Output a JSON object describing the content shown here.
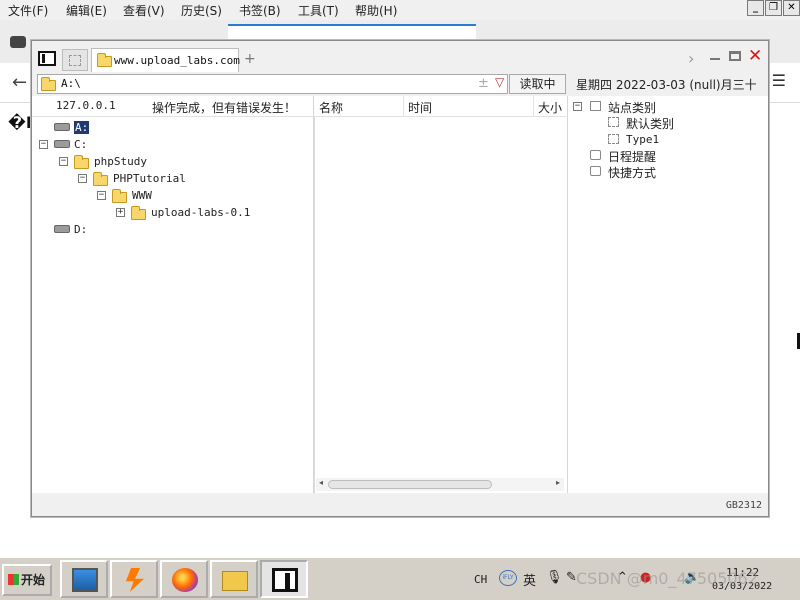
{
  "browser": {
    "menu": [
      "文件(F)",
      "编辑(E)",
      "查看(V)",
      "历史(S)",
      "书签(B)",
      "工具(T)",
      "帮助(H)"
    ],
    "window_controls": [
      "_",
      "❐",
      "✕"
    ],
    "page_glyph": "�P"
  },
  "app": {
    "tab_url": "www.upload_labs.com",
    "tab_add": "+",
    "address": "A:\\",
    "address_spinner": "±",
    "address_dropdown": "▽",
    "read_button": "读取中",
    "date_text": "星期四 2022-03-03 (null)月三十",
    "status_ip": "127.0.0.1",
    "status_msg": "操作完成，但有错误发生！",
    "columns": [
      "名称",
      "时间",
      "大小"
    ],
    "tree": [
      {
        "label": "A:",
        "type": "drive",
        "selected": true
      },
      {
        "label": "C:",
        "type": "drive",
        "expander": "−"
      },
      {
        "label": "phpStudy",
        "type": "folder",
        "expander": "−"
      },
      {
        "label": "PHPTutorial",
        "type": "folder",
        "expander": "−"
      },
      {
        "label": "WWW",
        "type": "folder",
        "expander": "−"
      },
      {
        "label": "upload-labs-0.1",
        "type": "folder",
        "expander": "+"
      },
      {
        "label": "D:",
        "type": "drive"
      }
    ],
    "bookmarks": {
      "root": "站点类别",
      "root_expander": "−",
      "children": [
        "默认类别",
        "Type1"
      ],
      "others": [
        "日程提醒",
        "快捷方式"
      ]
    },
    "encoding": "GB2312",
    "scroll_left": "◂",
    "scroll_right": "▸"
  },
  "taskbar": {
    "start_label": "开始",
    "tray_lang": "CH",
    "tray_ifly": "iFLY",
    "tray_ime": "英",
    "clock_time": "11:22",
    "clock_date": "03/03/2022"
  },
  "watermark": "CSDN @m0_47505062"
}
